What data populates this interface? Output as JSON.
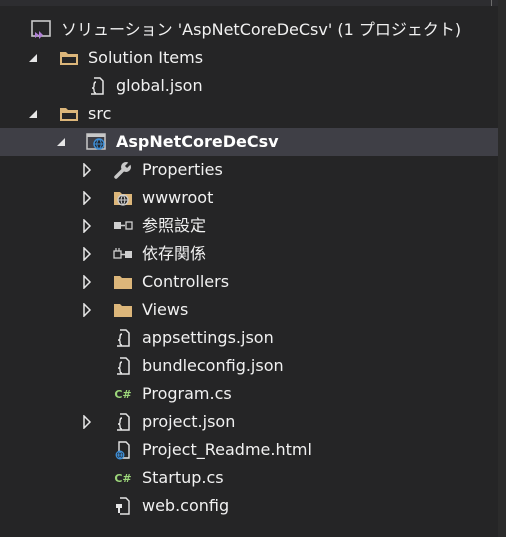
{
  "solution_explorer": {
    "solution_label": "ソリューション 'AspNetCoreDeCsv' (1 プロジェクト)",
    "items": [
      {
        "label": "Solution Items",
        "icon": "folder-icon"
      },
      {
        "label": "global.json",
        "icon": "json-file-icon"
      },
      {
        "label": "src",
        "icon": "folder-icon"
      },
      {
        "label": "AspNetCoreDeCsv",
        "icon": "web-project-icon",
        "selected": true
      },
      {
        "label": "Properties",
        "icon": "wrench-icon"
      },
      {
        "label": "wwwroot",
        "icon": "globe-folder-icon"
      },
      {
        "label": "参照設定",
        "icon": "references-icon"
      },
      {
        "label": "依存関係",
        "icon": "dependencies-icon"
      },
      {
        "label": "Controllers",
        "icon": "folder-icon"
      },
      {
        "label": "Views",
        "icon": "folder-icon"
      },
      {
        "label": "appsettings.json",
        "icon": "json-file-icon"
      },
      {
        "label": "bundleconfig.json",
        "icon": "json-file-icon"
      },
      {
        "label": "Program.cs",
        "icon": "csharp-file-icon"
      },
      {
        "label": "project.json",
        "icon": "json-file-icon"
      },
      {
        "label": "Project_Readme.html",
        "icon": "html-file-icon"
      },
      {
        "label": "Startup.cs",
        "icon": "csharp-file-icon"
      },
      {
        "label": "web.config",
        "icon": "config-file-icon"
      }
    ],
    "csharp_glyph": "C#"
  },
  "colors": {
    "background": "#252526",
    "selected_row": "#3f3f46",
    "text": "#f1f1f1",
    "folder": "#dcb67a",
    "csharp": "#9cd67a",
    "vs_purple": "#b180d7",
    "web_blue": "#3e8fd8"
  }
}
